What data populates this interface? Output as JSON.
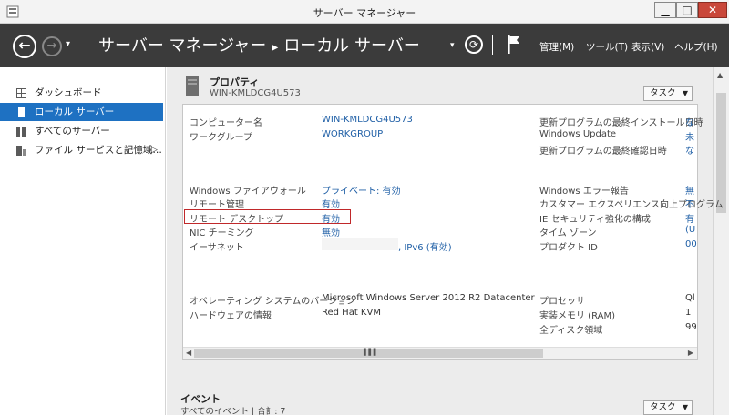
{
  "window": {
    "title": "サーバー マネージャー",
    "min": "▁",
    "max": "□",
    "close": "✕"
  },
  "toolbar": {
    "breadcrumb_root": "サーバー マネージャー",
    "breadcrumb_separator": "▸",
    "breadcrumb_current": "ローカル サーバー",
    "menus": [
      "管理(M)",
      "ツール(T)",
      "表示(V)",
      "ヘルプ(H)"
    ],
    "back_glyph": "←",
    "forward_glyph": "→",
    "dropdown_glyph": "▾",
    "refresh_glyph": "⟳"
  },
  "sidebar": {
    "items": [
      {
        "label": "ダッシュボード",
        "icon": "dashboard-icon"
      },
      {
        "label": "ローカル サーバー",
        "icon": "local-server-icon"
      },
      {
        "label": "すべてのサーバー",
        "icon": "all-servers-icon"
      },
      {
        "label": "ファイル サービスと記憶域…",
        "icon": "file-services-icon"
      }
    ],
    "expand_arrow": "▷"
  },
  "properties": {
    "title": "プロパティ",
    "subtitle": "WIN-KMLDCG4U573",
    "task_label": "タスク",
    "task_arrow": "▼",
    "left": [
      {
        "label": "コンピューター名",
        "value": "WIN-KMLDCG4U573"
      },
      {
        "label": "ワークグループ",
        "value": "WORKGROUP"
      },
      {
        "label": "Windows ファイアウォール",
        "value": "プライベート: 有効"
      },
      {
        "label": "リモート管理",
        "value": "有効"
      },
      {
        "label": "リモート デスクトップ",
        "value": "有効"
      },
      {
        "label": "NIC チーミング",
        "value": "無効"
      },
      {
        "label": "イーサネット",
        "value": ", IPv6 (有効)"
      },
      {
        "label": "オペレーティング システムのバージョン",
        "value": "Microsoft Windows Server 2012 R2 Datacenter"
      },
      {
        "label": "ハードウェアの情報",
        "value": "Red Hat KVM"
      }
    ],
    "right": [
      {
        "label": "更新プログラムの最終インストール日時",
        "value": "な"
      },
      {
        "label": "Windows Update",
        "value": "未"
      },
      {
        "label": "更新プログラムの最終確認日時",
        "value": "な"
      },
      {
        "label": "Windows エラー報告",
        "value": "無"
      },
      {
        "label": "カスタマー エクスペリエンス向上プログラム",
        "value": "不"
      },
      {
        "label": "IE セキュリティ強化の構成",
        "value": "有"
      },
      {
        "label": "タイム ゾーン",
        "value": "(U"
      },
      {
        "label": "プロダクト ID",
        "value": "00"
      },
      {
        "label": "プロセッサ",
        "value": "Ql"
      },
      {
        "label": "実装メモリ (RAM)",
        "value": "1"
      },
      {
        "label": "全ディスク領域",
        "value": "99"
      }
    ]
  },
  "scrollbar": {
    "left": "◀",
    "right": "▶",
    "up": "▲",
    "grip": "▌▌▌"
  },
  "events": {
    "title": "イベント",
    "subtitle": "すべてのイベント | 合計: 7",
    "task_label": "タスク",
    "task_arrow": "▼"
  },
  "colors": {
    "accent": "#1e71c2",
    "toolbar": "#3b3b3b",
    "highlight": "#c0282a",
    "link": "#1f5fa6"
  }
}
